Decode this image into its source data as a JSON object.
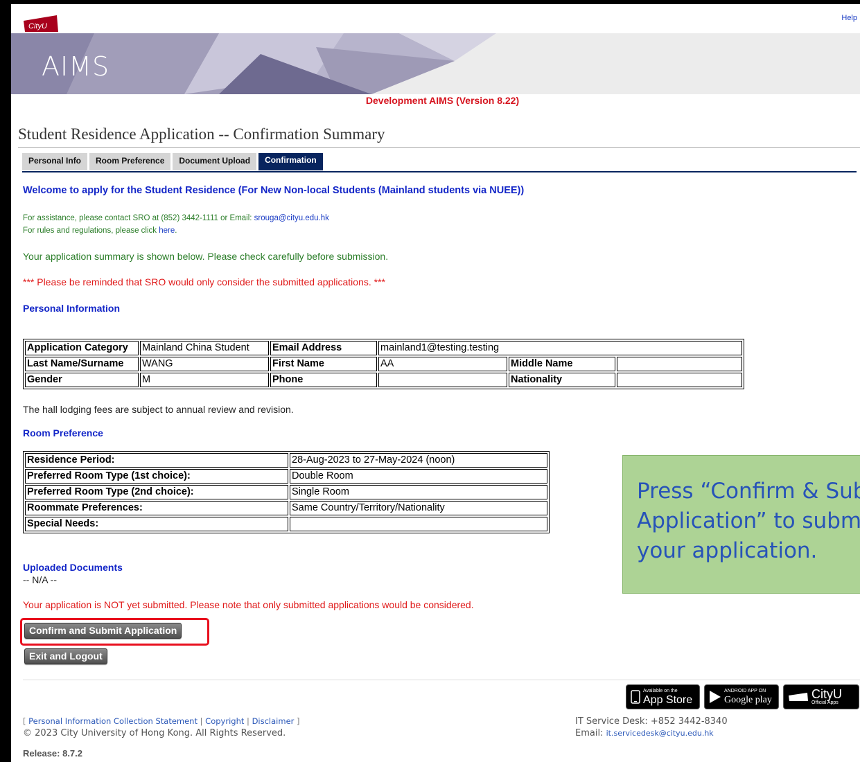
{
  "header": {
    "logo_text": "CityU",
    "help_label": "Help",
    "app_name": "AIMS",
    "environment_notice": "Development AIMS (Version 8.22)"
  },
  "page_title": "Student Residence Application -- Confirmation Summary",
  "tabs": [
    {
      "label": "Personal Info",
      "active": false
    },
    {
      "label": "Room Preference",
      "active": false
    },
    {
      "label": "Document Upload",
      "active": false
    },
    {
      "label": "Confirmation",
      "active": true
    }
  ],
  "welcome": "Welcome to apply for the Student Residence (For New Non-local Students (Mainland students via NUEE))",
  "assistance": {
    "line1_prefix": "For assistance, please contact SRO at (852) 3442-1111 or Email: ",
    "email": "srouga@cityu.edu.hk",
    "line2_prefix": "For rules and regulations, please click ",
    "rules_link": "here",
    "line2_suffix": "."
  },
  "summary_note": "Your application summary is shown below. Please check carefully before submission.",
  "reminder": "*** Please be reminded that SRO would only consider the submitted applications. ***",
  "personal_info": {
    "heading": "Personal Information",
    "application_category_label": "Application Category",
    "application_category": "Mainland China Student",
    "email_label": "Email Address",
    "email": "mainland1@testing.testing",
    "last_name_label": "Last Name/Surname",
    "last_name": "WANG",
    "first_name_label": "First Name",
    "first_name": "AA",
    "middle_name_label": "Middle Name",
    "middle_name": "",
    "gender_label": "Gender",
    "gender": "M",
    "phone_label": "Phone",
    "phone": "",
    "nationality_label": "Nationality",
    "nationality": ""
  },
  "fees_note": "The hall lodging fees are subject to annual review and revision.",
  "room_preference": {
    "heading": "Room Preference",
    "rows": [
      {
        "label": "Residence Period:",
        "value": "28-Aug-2023 to 27-May-2024 (noon)"
      },
      {
        "label": "Preferred Room Type (1st choice):",
        "value": "Double Room"
      },
      {
        "label": "Preferred Room Type (2nd choice):",
        "value": "Single Room"
      },
      {
        "label": "Roommate Preferences:",
        "value": "Same Country/Territory/Nationality"
      },
      {
        "label": "Special Needs:",
        "value": ""
      }
    ]
  },
  "uploaded_documents": {
    "heading": "Uploaded Documents",
    "value": "-- N/A --"
  },
  "not_submitted_notice": "Your application is NOT yet submitted. Please note that only submitted applications would be considered.",
  "buttons": {
    "confirm_label": "Confirm and Submit Application",
    "exit_label": "Exit and Logout"
  },
  "callout": "Press “Confirm & Submit\nApplication” to submit\nyour application.",
  "badges": {
    "apple_small": "Available on the",
    "apple_big": "App Store",
    "google_small": "ANDROID APP ON",
    "google_big": "Google play",
    "cityu_big": "CityU",
    "cityu_small": "Official Apps"
  },
  "footer": {
    "bracket_open": "[ ",
    "pics_link": "Personal Information Collection Statement",
    "sep": " | ",
    "copyright_link": "Copyright",
    "disclaimer_link": "Disclaimer",
    "bracket_close": " ]",
    "copyright_text": "© 2023 City University of Hong Kong. All Rights Reserved.",
    "release": "Release: 8.7.2",
    "it_desk": "IT Service Desk: +852 3442-8340",
    "it_email_prefix": "Email: ",
    "it_email": "it.servicedesk@cityu.edu.hk"
  },
  "colors": {
    "tab_active": "#08245e",
    "heading_blue": "#1427c8",
    "notice_red": "#e01a1a",
    "callout_bg": "#add395",
    "highlight_red": "#e8101e"
  }
}
